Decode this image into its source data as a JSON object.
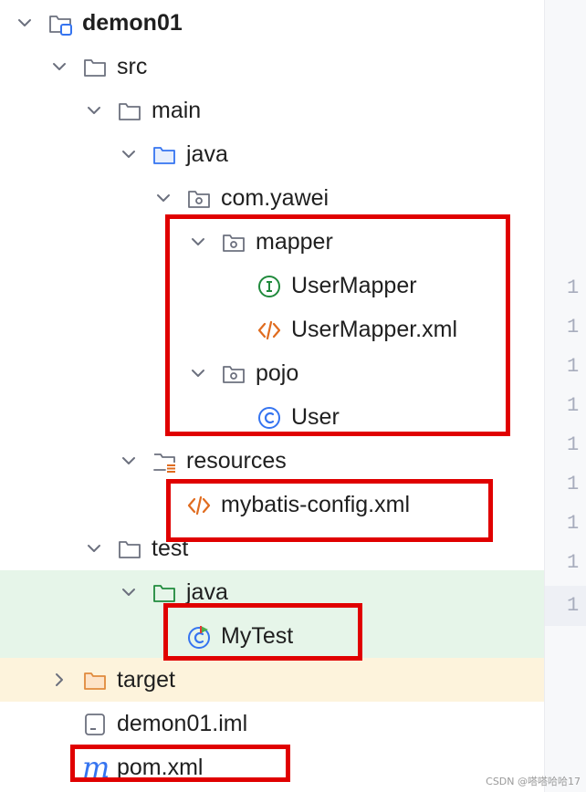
{
  "project_tree": {
    "items": [
      {
        "label": "demon01",
        "icon": "module-folder-icon"
      },
      {
        "label": "src",
        "icon": "folder-icon"
      },
      {
        "label": "main",
        "icon": "folder-icon"
      },
      {
        "label": "java",
        "icon": "source-root-folder-icon"
      },
      {
        "label": "com.yawei",
        "icon": "package-icon"
      },
      {
        "label": "mapper",
        "icon": "package-icon"
      },
      {
        "label": "UserMapper",
        "icon": "interface-icon"
      },
      {
        "label": "UserMapper.xml",
        "icon": "xml-file-icon"
      },
      {
        "label": "pojo",
        "icon": "package-icon"
      },
      {
        "label": "User",
        "icon": "class-icon"
      },
      {
        "label": "resources",
        "icon": "resources-folder-icon"
      },
      {
        "label": "mybatis-config.xml",
        "icon": "xml-file-icon"
      },
      {
        "label": "test",
        "icon": "folder-icon"
      },
      {
        "label": "java",
        "icon": "test-source-root-folder-icon"
      },
      {
        "label": "MyTest",
        "icon": "test-class-icon"
      },
      {
        "label": "target",
        "icon": "excluded-folder-icon"
      },
      {
        "label": "demon01.iml",
        "icon": "iml-file-icon"
      },
      {
        "label": "pom.xml",
        "icon": "maven-icon"
      }
    ]
  },
  "editor_gutter": {
    "line_numbers": [
      "1",
      "1",
      "1",
      "1",
      "1",
      "1",
      "1",
      "1",
      "1"
    ]
  },
  "colors": {
    "highlight_box": "#e00000",
    "test_root_bg": "#e6f5e9",
    "excluded_bg": "#fdf3dc"
  },
  "watermark": "CSDN @嗒嗒哈哈17"
}
